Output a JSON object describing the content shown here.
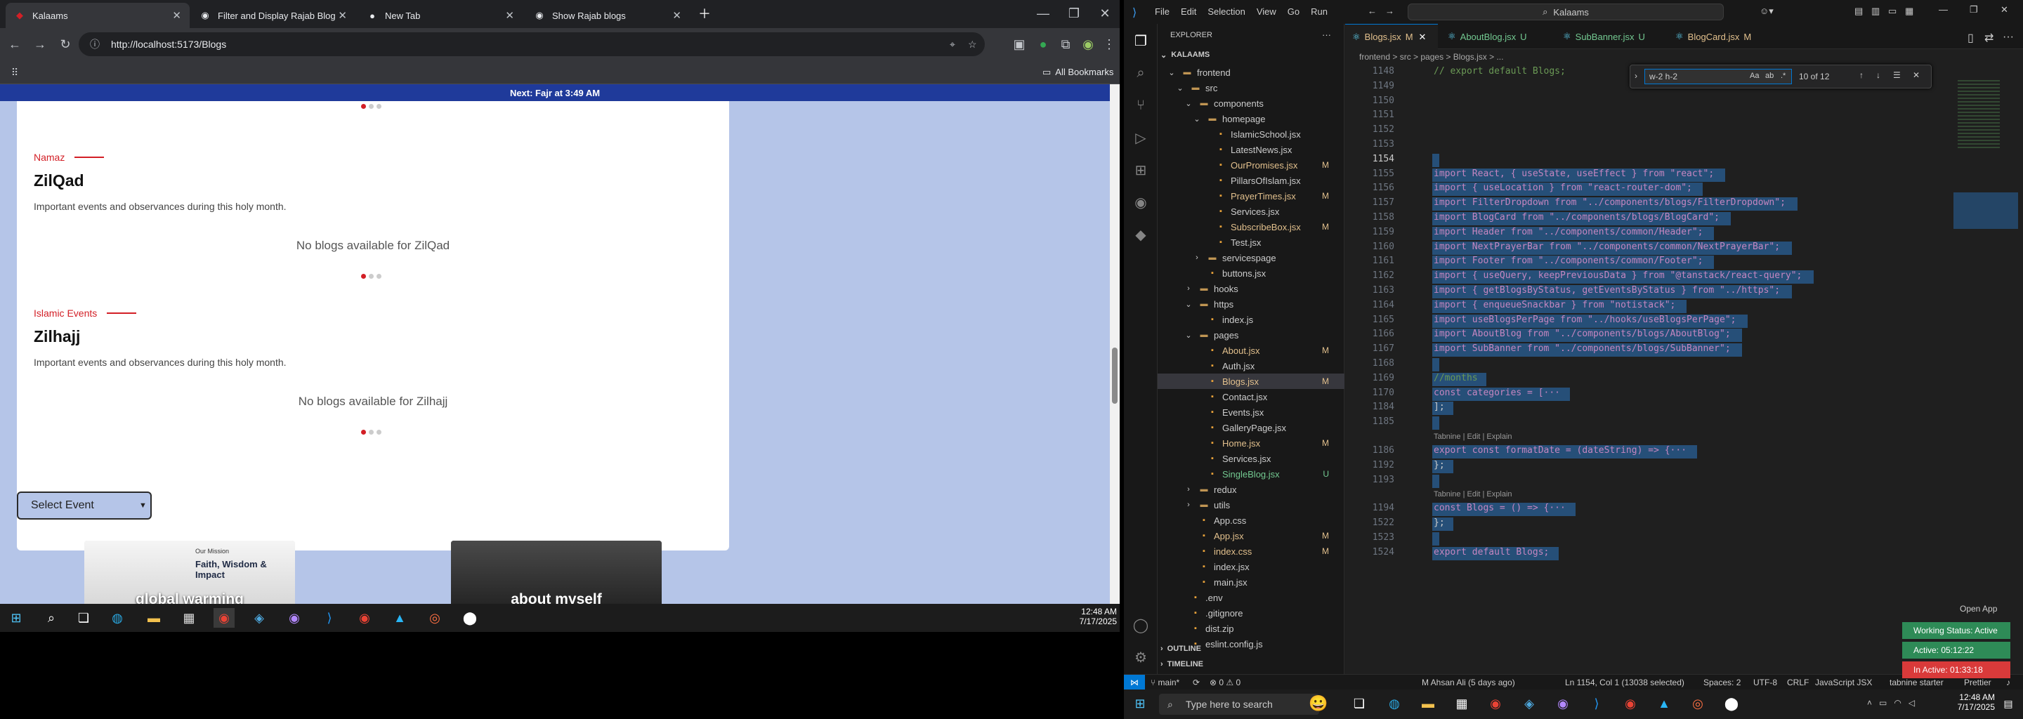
{
  "chrome": {
    "tabs": [
      {
        "title": "Kalaams",
        "active": true
      },
      {
        "title": "Filter and Display Rajab Blog In",
        "active": false
      },
      {
        "title": "New Tab",
        "active": false
      },
      {
        "title": "Show Rajab blogs",
        "active": false
      }
    ],
    "url": "http://localhost:5173/Blogs",
    "bookmarks_label": "All Bookmarks"
  },
  "webpage": {
    "next_prayer": "Next: Fajr at 3:49 AM",
    "months": [
      {
        "category": "Namaz",
        "name": "ZilQad",
        "desc": "Important events and observances during this holy month.",
        "empty": "No blogs available for ZilQad"
      },
      {
        "category": "Islamic Events",
        "name": "Zilhajj",
        "desc": "Important events and observances during this holy month.",
        "empty": "No blogs available for Zilhajj"
      }
    ],
    "select_event": "Select Event",
    "blog_cards": [
      {
        "kicker": "Our Mission",
        "headline": "Faith, Wisdom & Impact",
        "title": "global warming"
      },
      {
        "title": "about myself"
      }
    ]
  },
  "taskbar_left": {
    "time": "12:48 AM",
    "date": "7/17/2025"
  },
  "vscode": {
    "title": "Kalaams",
    "menu": [
      "File",
      "Edit",
      "Selection",
      "View",
      "Go",
      "Run"
    ],
    "explorer_header": "EXPLORER",
    "workspace": "KALAAMS",
    "tree": [
      {
        "label": "frontend",
        "type": "folder-open",
        "depth": 1
      },
      {
        "label": "src",
        "type": "folder-open",
        "depth": 2
      },
      {
        "label": "components",
        "type": "folder-open",
        "depth": 3
      },
      {
        "label": "homepage",
        "type": "folder-open",
        "depth": 4
      },
      {
        "label": "IslamicSchool.jsx",
        "type": "file",
        "depth": 5
      },
      {
        "label": "LatestNews.jsx",
        "type": "file",
        "depth": 5
      },
      {
        "label": "OurPromises.jsx",
        "type": "file",
        "depth": 5,
        "mark": "M"
      },
      {
        "label": "PillarsOfIslam.jsx",
        "type": "file",
        "depth": 5
      },
      {
        "label": "PrayerTimes.jsx",
        "type": "file",
        "depth": 5,
        "mark": "M"
      },
      {
        "label": "Services.jsx",
        "type": "file",
        "depth": 5
      },
      {
        "label": "SubscribeBox.jsx",
        "type": "file",
        "depth": 5,
        "mark": "M"
      },
      {
        "label": "Test.jsx",
        "type": "file",
        "depth": 5
      },
      {
        "label": "servicespage",
        "type": "folder",
        "depth": 4
      },
      {
        "label": "buttons.jsx",
        "type": "file",
        "depth": 4
      },
      {
        "label": "hooks",
        "type": "folder",
        "depth": 3
      },
      {
        "label": "https",
        "type": "folder-open",
        "depth": 3
      },
      {
        "label": "index.js",
        "type": "file",
        "depth": 4
      },
      {
        "label": "pages",
        "type": "folder-open",
        "depth": 3
      },
      {
        "label": "About.jsx",
        "type": "file",
        "depth": 4,
        "mark": "M"
      },
      {
        "label": "Auth.jsx",
        "type": "file",
        "depth": 4
      },
      {
        "label": "Blogs.jsx",
        "type": "file",
        "depth": 4,
        "mark": "M",
        "selected": true
      },
      {
        "label": "Contact.jsx",
        "type": "file",
        "depth": 4
      },
      {
        "label": "Events.jsx",
        "type": "file",
        "depth": 4
      },
      {
        "label": "GalleryPage.jsx",
        "type": "file",
        "depth": 4
      },
      {
        "label": "Home.jsx",
        "type": "file",
        "depth": 4,
        "mark": "M"
      },
      {
        "label": "Services.jsx",
        "type": "file",
        "depth": 4
      },
      {
        "label": "SingleBlog.jsx",
        "type": "file",
        "depth": 4,
        "mark": "U"
      },
      {
        "label": "redux",
        "type": "folder",
        "depth": 3
      },
      {
        "label": "utils",
        "type": "folder",
        "depth": 3
      },
      {
        "label": "App.css",
        "type": "file",
        "depth": 3
      },
      {
        "label": "App.jsx",
        "type": "file",
        "depth": 3,
        "mark": "M"
      },
      {
        "label": "index.css",
        "type": "file",
        "depth": 3,
        "mark": "M"
      },
      {
        "label": "index.jsx",
        "type": "file",
        "depth": 3
      },
      {
        "label": "main.jsx",
        "type": "file",
        "depth": 3
      },
      {
        "label": ".env",
        "type": "file",
        "depth": 2
      },
      {
        "label": ".gitignore",
        "type": "file",
        "depth": 2
      },
      {
        "label": "dist.zip",
        "type": "file",
        "depth": 2
      },
      {
        "label": "eslint.config.js",
        "type": "file",
        "depth": 2
      }
    ],
    "outline_label": "OUTLINE",
    "timeline_label": "TIMELINE",
    "editor_tabs": [
      {
        "label": "Blogs.jsx",
        "mark": "M",
        "active": true
      },
      {
        "label": "AboutBlog.jsx",
        "mark": "U"
      },
      {
        "label": "SubBanner.jsx",
        "mark": "U"
      },
      {
        "label": "BlogCard.jsx",
        "mark": "M"
      }
    ],
    "breadcrumb": "frontend > src > pages > Blogs.jsx > ...",
    "find": {
      "query": "w-2 h-2",
      "result": "10 of 12"
    },
    "code_lines": [
      {
        "n": "1148",
        "t": "// export default Blogs;"
      },
      {
        "n": "1149",
        "t": ""
      },
      {
        "n": "1150",
        "t": ""
      },
      {
        "n": "1151",
        "t": ""
      },
      {
        "n": "1152",
        "t": ""
      },
      {
        "n": "1153",
        "t": ""
      },
      {
        "n": "1154",
        "t": ""
      },
      {
        "n": "1155",
        "t": "import React, { useState, useEffect } from \"react\";"
      },
      {
        "n": "1156",
        "t": "import { useLocation } from \"react-router-dom\";"
      },
      {
        "n": "1157",
        "t": "import FilterDropdown from \"../components/blogs/FilterDropdown\";"
      },
      {
        "n": "1158",
        "t": "import BlogCard from \"../components/blogs/BlogCard\";"
      },
      {
        "n": "1159",
        "t": "import Header from \"../components/common/Header\";"
      },
      {
        "n": "1160",
        "t": "import NextPrayerBar from \"../components/common/NextPrayerBar\";"
      },
      {
        "n": "1161",
        "t": "import Footer from \"../components/common/Footer\";"
      },
      {
        "n": "1162",
        "t": "import { useQuery, keepPreviousData } from \"@tanstack/react-query\";"
      },
      {
        "n": "1163",
        "t": "import { getBlogsByStatus, getEventsByStatus } from \"../https\";"
      },
      {
        "n": "1164",
        "t": "import { enqueueSnackbar } from \"notistack\";"
      },
      {
        "n": "1165",
        "t": "import useBlogsPerPage from \"../hooks/useBlogsPerPage\";"
      },
      {
        "n": "1166",
        "t": "import AboutBlog from \"../components/blogs/AboutBlog\";"
      },
      {
        "n": "1167",
        "t": "import SubBanner from \"../components/blogs/SubBanner\";"
      },
      {
        "n": "1168",
        "t": ""
      },
      {
        "n": "1169",
        "t": "//months"
      },
      {
        "n": "1170",
        "t": "const categories = [···"
      },
      {
        "n": "1184",
        "t": "];"
      },
      {
        "n": "1185",
        "t": ""
      },
      {
        "n": "1186",
        "t": "export const formatDate = (dateString) => {···"
      },
      {
        "n": "1192",
        "t": "};"
      },
      {
        "n": "1193",
        "t": ""
      },
      {
        "n": "1194",
        "t": "const Blogs = () => {···"
      },
      {
        "n": "1522",
        "t": "};"
      },
      {
        "n": "1523",
        "t": ""
      },
      {
        "n": "1524",
        "t": "export default Blogs;"
      }
    ],
    "code_lens": "Tabnine | Edit | Explain",
    "status": {
      "branch": "main*",
      "problems": "0 ⚠ 0",
      "author": "M Ahsan Ali (5 days ago)",
      "position": "Ln 1154, Col 1 (13038 selected)",
      "spaces": "Spaces: 2",
      "encoding": "UTF-8",
      "eol": "CRLF",
      "language": "JavaScript JSX",
      "tabnine": "tabnine starter",
      "prettier": "Prettier"
    },
    "open_app": "Open App"
  },
  "timer": {
    "working": "Working Status: Active",
    "active": "Active: 05:12:22",
    "inactive": "In Active: 01:33:18"
  },
  "taskbar_right": {
    "search_placeholder": "Type here to search",
    "time": "12:48 AM",
    "date": "7/17/2025"
  }
}
